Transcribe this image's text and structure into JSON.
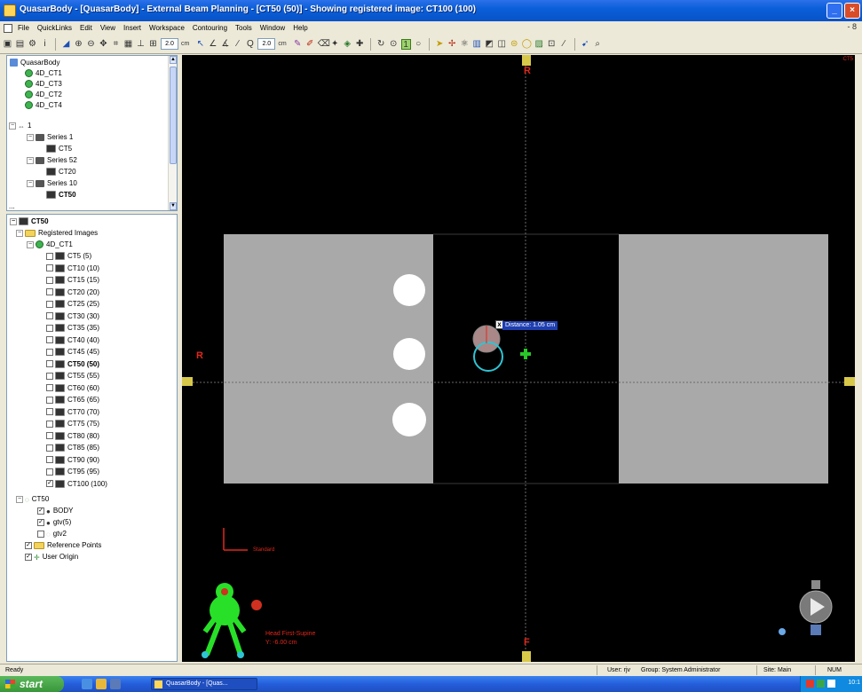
{
  "window": {
    "title": "QuasarBody - [QuasarBody] - External Beam Planning - [CT50 (50)] - Showing registered image: CT100 (100)"
  },
  "menu": {
    "items": [
      "File",
      "QuickLinks",
      "Edit",
      "View",
      "Insert",
      "Workspace",
      "Contouring",
      "Tools",
      "Window",
      "Help"
    ],
    "right": "- 8"
  },
  "toolbar": {
    "field1": "2.0",
    "unit1": "cm",
    "field2": "2.0",
    "unit2": "cm",
    "toggle": "1"
  },
  "tree_top": {
    "root": "QuasarBody",
    "items": [
      "4D_CT1",
      "4D_CT3",
      "4D_CT2",
      "4D_CT4"
    ],
    "patient": "1",
    "series1": "Series 1",
    "ct5": "CT5",
    "series52": "Series 52",
    "ct20": "CT20",
    "series10": "Series 10",
    "ct50": "CT50",
    "more": "..."
  },
  "tree_bottom": {
    "root": "CT50",
    "registered": "Registered Images",
    "group": "4D_CT1",
    "images": [
      "CT5 (5)",
      "CT10 (10)",
      "CT15 (15)",
      "CT20 (20)",
      "CT25 (25)",
      "CT30 (30)",
      "CT35 (35)",
      "CT40 (40)",
      "CT45 (45)",
      "CT50 (50)",
      "CT55 (55)",
      "CT60 (60)",
      "CT65 (65)",
      "CT70 (70)",
      "CT75 (75)",
      "CT80 (80)",
      "CT85 (85)",
      "CT90 (90)",
      "CT95 (95)",
      "CT100 (100)"
    ],
    "structure_set": "CT50",
    "structures": [
      "BODY",
      "gtv(5)",
      "gtv2"
    ],
    "ref_points": "Reference Points",
    "user_origin": "User Origin"
  },
  "viewer": {
    "marker_top": "R",
    "marker_left": "R",
    "marker_bottom": "F",
    "distance_label": "Distance: 1.05 cm",
    "close_glyph": "x",
    "standard_label": "Standard",
    "orientation_line1": "Head First-Supine",
    "orientation_line2": "Y: -6.00 cm",
    "right_top_text": "CT5"
  },
  "statusbar": {
    "ready": "Ready",
    "user": "User: rjv",
    "group": "Group: System Administrator",
    "site": "Site: Main",
    "num": "NUM"
  },
  "taskbar": {
    "start": "start",
    "app": "QuasarBody - [Quas...",
    "clock": "10:1"
  },
  "colors": {
    "accent": "#0a5fd8",
    "marker": "#e0281c",
    "crosshair_green": "#28c828",
    "phantom_gray": "#a9a9a9"
  }
}
